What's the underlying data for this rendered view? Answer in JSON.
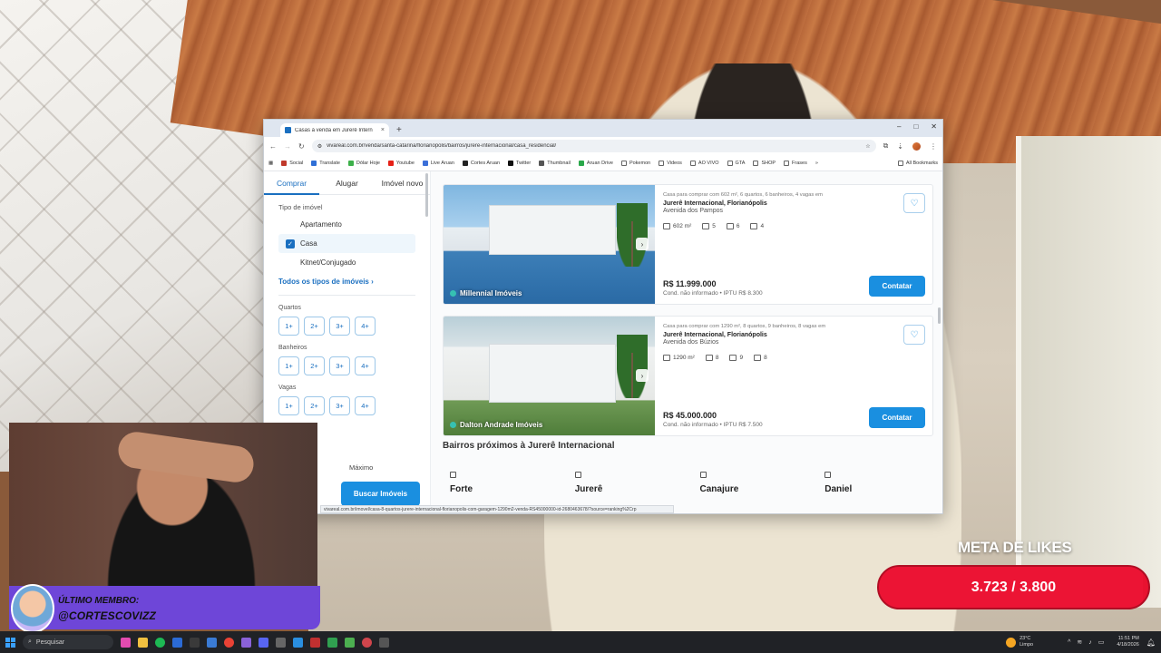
{
  "browser": {
    "tab_title": "Casas à venda em Jurerê Intern",
    "tab_close": "×",
    "new_tab": "+",
    "win_min": "–",
    "win_max": "□",
    "win_close": "✕",
    "url": "vivareal.com.br/venda/santa-catarina/florianopolis/bairros/jurere-internacional/casa_residencial/",
    "bookmarks": [
      "Social",
      "Translate",
      "Dólar Hoje",
      "Youtube",
      "Live Aruan",
      "Cortes Aruan",
      "Twitter",
      "Thumbnail",
      "Aruan Drive",
      "Pokemon",
      "Videos",
      "AO VIVO",
      "GTA",
      "SHOP",
      "Frases"
    ],
    "bookmarks_more": "»",
    "all_bookmarks": "All Bookmarks",
    "status_url": "vivareal.com.br/imovel/casa-8-quartos-jurere-internacional-florianopolis-com-garagem-1290m2-venda-RS45000000-id-2680463678/?source=ranking%2Crp"
  },
  "filters": {
    "tabs": [
      "Comprar",
      "Alugar",
      "Imóvel novo"
    ],
    "tipo_title": "Tipo de imóvel",
    "types": [
      {
        "label": "Apartamento",
        "checked": false
      },
      {
        "label": "Casa",
        "checked": true
      },
      {
        "label": "Kitnet/Conjugado",
        "checked": false
      }
    ],
    "all_types": "Todos os tipos de imóveis",
    "quartos_label": "Quartos",
    "banheiros_label": "Banheiros",
    "vagas_label": "Vagas",
    "options": [
      "1+",
      "2+",
      "3+",
      "4+"
    ],
    "maximo": "Máximo",
    "buscar": "Buscar Imóveis"
  },
  "listings": [
    {
      "agency": "Millennial Imóveis",
      "desc": "Casa para comprar com 602 m², 6 quartos, 6 banheiros, 4 vagas em",
      "location": "Jurerê Internacional, Florianópolis",
      "street": "Avenida dos Pampos",
      "area": "602 m²",
      "quartos": "5",
      "banheiros": "6",
      "vagas": "4",
      "price": "R$ 11.999.000",
      "cond": "Cond. não informado • IPTU R$ 8.300",
      "contact": "Contatar"
    },
    {
      "agency": "Dalton Andrade Imóveis",
      "desc": "Casa para comprar com 1290 m², 8 quartos, 9 banheiros, 8 vagas em",
      "location": "Jurerê Internacional, Florianópolis",
      "street": "Avenida dos Búzios",
      "area": "1290 m²",
      "quartos": "8",
      "banheiros": "9",
      "vagas": "8",
      "price": "R$ 45.000.000",
      "cond": "Cond. não informado • IPTU R$ 7.500",
      "contact": "Contatar"
    }
  ],
  "nearby": {
    "title": "Bairros próximos à Jurerê Internacional",
    "items": [
      "Forte",
      "Jurerê",
      "Canajure",
      "Daniel"
    ]
  },
  "overlay": {
    "ultimo_label": "Último membro:",
    "ultimo_name": "@CORTESCOVIZZ",
    "meta_title": "META DE LIKES",
    "meta_count": "3.723 / 3.800",
    "meta_progress": 0.98
  },
  "taskbar": {
    "search": "Pesquisar",
    "temp": "23°C",
    "weather": "Limpo",
    "time": "11:51 PM",
    "date": "4/18/2026"
  },
  "colors": {
    "brand_blue": "#1a8fe0",
    "goal_red": "#e81230",
    "banner_purple": "#6e46d8"
  }
}
